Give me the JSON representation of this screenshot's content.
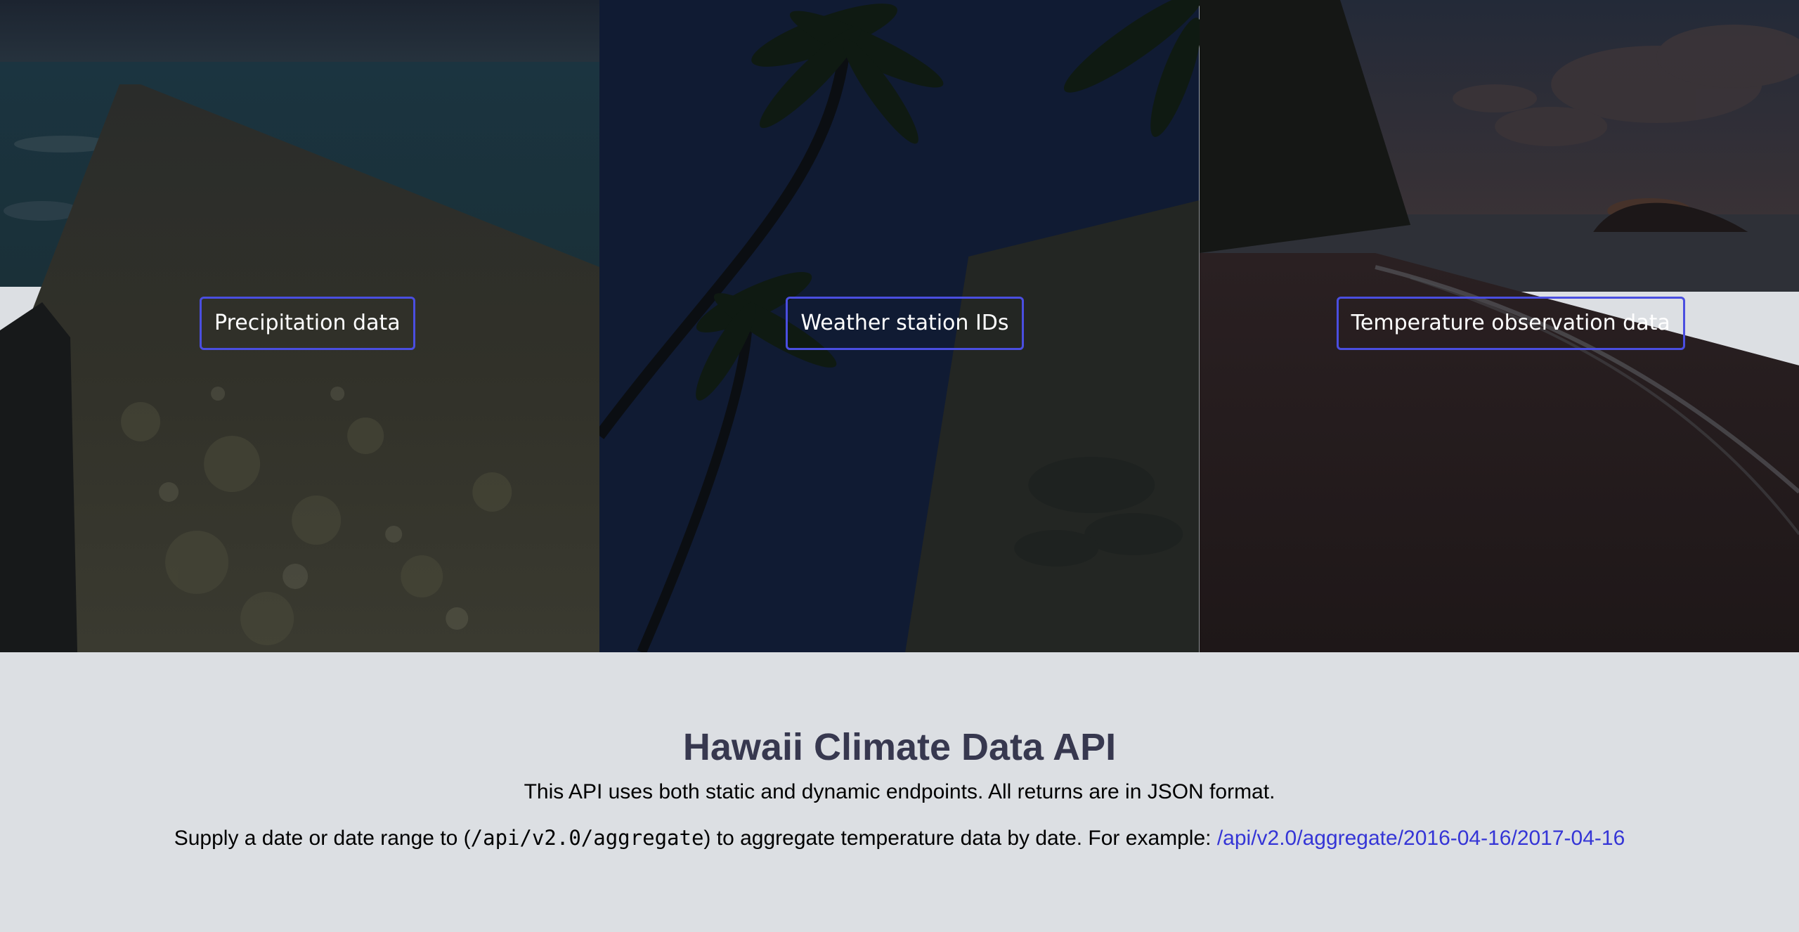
{
  "hero": {
    "panels": [
      {
        "id": "precipitation",
        "button_label": "Precipitation data",
        "scene": "seawall-ocean"
      },
      {
        "id": "stations",
        "button_label": "Weather station IDs",
        "scene": "palm-trees-night"
      },
      {
        "id": "temperature",
        "button_label": "Temperature observation data",
        "scene": "beach-sunset"
      }
    ]
  },
  "info": {
    "title": "Hawaii Climate Data API",
    "description": "This API uses both static and dynamic endpoints. All returns are in JSON format.",
    "supply_prefix": "Supply a date or date range to (",
    "supply_code": "/api/v2.0/aggregate",
    "supply_suffix": ") to aggregate temperature data by date. For example: ",
    "example_link": "/api/v2.0/aggregate/2016-04-16/2017-04-16"
  },
  "colors": {
    "button_border": "#4a4ee0",
    "title": "#37384f",
    "link": "#3535d6",
    "background": "#dcdfe3"
  }
}
